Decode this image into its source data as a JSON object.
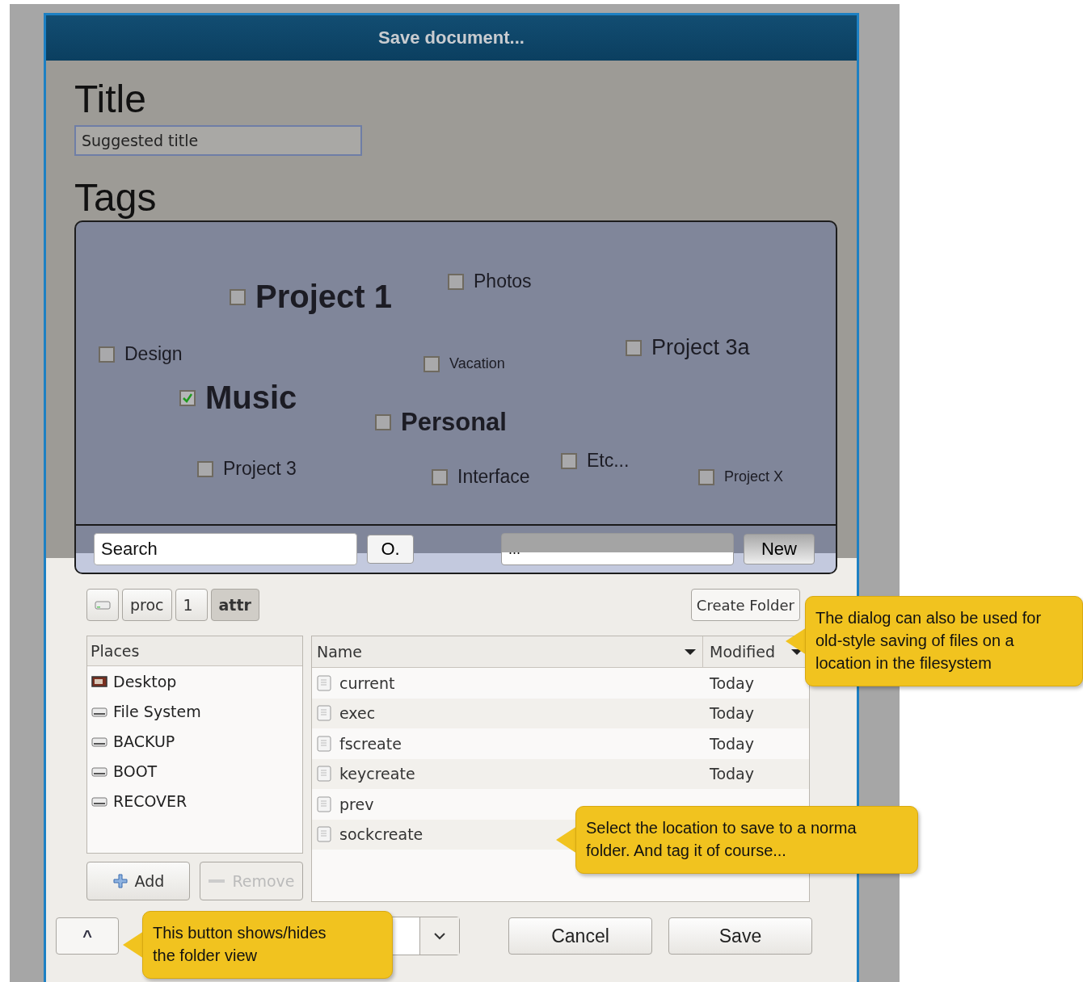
{
  "window": {
    "title": "Save document..."
  },
  "title_section": {
    "heading": "Title",
    "field": {
      "value": "Suggested title"
    }
  },
  "tags_section": {
    "heading": "Tags",
    "tags": [
      {
        "label": "Project 1",
        "kind": "major",
        "checked": false
      },
      {
        "label": "Photos",
        "kind": "normal",
        "checked": false
      },
      {
        "label": "Design",
        "kind": "normal",
        "checked": false
      },
      {
        "label": "Vacation",
        "kind": "small",
        "checked": false
      },
      {
        "label": "Project 3a",
        "kind": "large",
        "checked": false
      },
      {
        "label": "Music",
        "kind": "major",
        "checked": true
      },
      {
        "label": "Personal",
        "kind": "bold",
        "checked": false
      },
      {
        "label": "Project 3",
        "kind": "normal",
        "checked": false
      },
      {
        "label": "Interface",
        "kind": "normal",
        "checked": false
      },
      {
        "label": "Etc...",
        "kind": "normal",
        "checked": false
      },
      {
        "label": "Project X",
        "kind": "small",
        "checked": false
      }
    ],
    "search": {
      "value": "Search"
    },
    "search_button": "O.",
    "new_tag_field": {
      "value": "..."
    },
    "new_button": "New"
  },
  "path_bar": {
    "segments": [
      {
        "kind": "drive",
        "selected": false
      },
      {
        "kind": "text",
        "label": "proc",
        "selected": false
      },
      {
        "kind": "text",
        "label": "1",
        "selected": false
      },
      {
        "kind": "text",
        "label": "attr",
        "selected": true
      }
    ],
    "create_folder": "Create Folder"
  },
  "places": {
    "heading": "Places",
    "items": [
      {
        "label": "Desktop",
        "kind": "desktop"
      },
      {
        "label": "File System",
        "kind": "drive"
      },
      {
        "label": "BACKUP",
        "kind": "drive"
      },
      {
        "label": "BOOT",
        "kind": "drive"
      },
      {
        "label": "RECOVER",
        "kind": "drive"
      }
    ],
    "buttons": [
      {
        "label": "Add",
        "kind": "add",
        "disabled": false
      },
      {
        "label": "Remove",
        "kind": "remove",
        "disabled": true
      }
    ]
  },
  "files": {
    "columns": [
      "Name",
      "Modified"
    ],
    "rows": [
      {
        "name": "current",
        "modified": "Today"
      },
      {
        "name": "exec",
        "modified": "Today"
      },
      {
        "name": "fscreate",
        "modified": "Today"
      },
      {
        "name": "keycreate",
        "modified": "Today"
      },
      {
        "name": "prev"
      },
      {
        "name": "sockcreate"
      }
    ]
  },
  "bottom_bar": {
    "toggle_button": "^",
    "cancel": "Cancel",
    "save": "Save"
  },
  "callouts": [
    {
      "kind": "left",
      "lines": [
        "The dialog can also be used for",
        "old-style saving of files on a",
        "location in the filesystem"
      ]
    },
    {
      "kind": "left",
      "lines": [
        "Select the location to save to a norma",
        "folder. And tag it of course..."
      ]
    },
    {
      "kind": "left",
      "lines": [
        "This button shows/hides",
        "the folder view"
      ]
    }
  ]
}
